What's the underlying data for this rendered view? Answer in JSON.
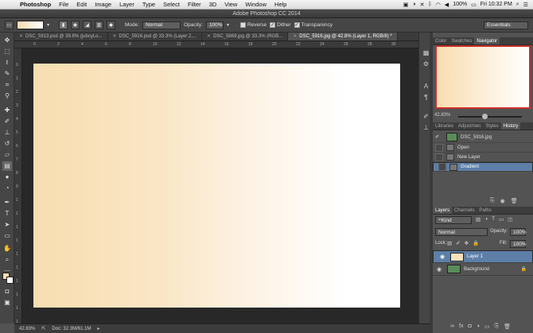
{
  "menubar": {
    "app": "Photoshop",
    "items": [
      "File",
      "Edit",
      "Image",
      "Layer",
      "Type",
      "Select",
      "Filter",
      "3D",
      "View",
      "Window",
      "Help"
    ],
    "battery": "100%",
    "clock": "Fri 10:32 PM"
  },
  "window": {
    "title": "Adobe Photoshop CC 2014"
  },
  "options": {
    "mode_label": "Mode:",
    "mode_value": "Normal",
    "opacity_label": "Opacity:",
    "opacity_value": "100%",
    "reverse": "Reverse",
    "dither": "Dither",
    "transparency": "Transparency",
    "workspace": "Essentials"
  },
  "tabs": [
    {
      "label": "DSC_5913.psd @ 39.8% (jubcyLo..."
    },
    {
      "label": "DSC_5916.psd @ 33.3% (Layer 2,..."
    },
    {
      "label": "DSC_5869.jpg @ 33.3% (RGB..."
    },
    {
      "label": "DSC_5916.jpg @ 42.8% (Layer 1, RGB/8) *"
    }
  ],
  "ruler": {
    "h": [
      "0",
      "2",
      "4",
      "6",
      "8",
      "10",
      "12",
      "14",
      "16",
      "18",
      "20",
      "22",
      "24",
      "26",
      "28",
      "30"
    ],
    "v": [
      "0",
      "1",
      "2",
      "3",
      "4",
      "5",
      "6",
      "7",
      "8",
      "9",
      "1",
      "1",
      "1",
      "1",
      "1",
      "1",
      "1",
      "1",
      "1",
      "1"
    ]
  },
  "status": {
    "zoom": "42.83%",
    "doc": "Doc: 32.3M/61.1M"
  },
  "navigator": {
    "tabs": [
      "Color",
      "Swatches",
      "Navigator"
    ],
    "zoom": "42.83%"
  },
  "history": {
    "tabs": [
      "Libraries",
      "Adjustmen",
      "Styles",
      "History"
    ],
    "snapshot": "DSC_5916.jpg",
    "items": [
      "Open",
      "New Layer",
      "Gradient"
    ]
  },
  "layers": {
    "tabs": [
      "Layers",
      "Channels",
      "Paths"
    ],
    "kind": "Kind",
    "blend": "Normal",
    "opacity_label": "Opacity:",
    "opacity_value": "100%",
    "lock_label": "Lock:",
    "fill_label": "Fill:",
    "fill_value": "100%",
    "items": [
      "Layer 1",
      "Background"
    ]
  }
}
